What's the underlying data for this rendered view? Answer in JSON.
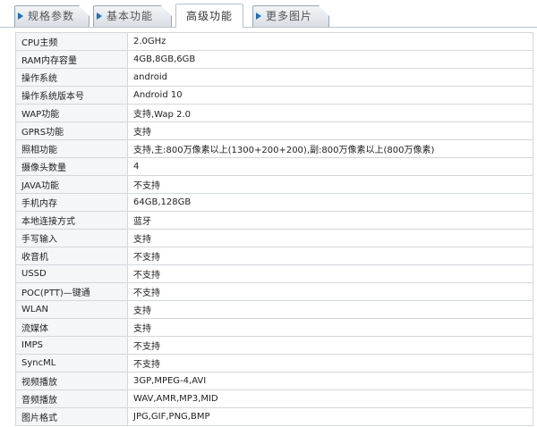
{
  "tabs": [
    {
      "label": "规格参数",
      "active": false
    },
    {
      "label": "基本功能",
      "active": false
    },
    {
      "label": "高级功能",
      "active": true
    },
    {
      "label": "更多图片",
      "active": false
    }
  ],
  "specs": [
    {
      "label": "CPU主频",
      "value": "2.0GHz"
    },
    {
      "label": "RAM内存容量",
      "value": "4GB,8GB,6GB"
    },
    {
      "label": "操作系统",
      "value": "android"
    },
    {
      "label": "操作系统版本号",
      "value": "Android 10"
    },
    {
      "label": "WAP功能",
      "value": "支持,Wap 2.0"
    },
    {
      "label": "GPRS功能",
      "value": "支持"
    },
    {
      "label": "照相功能",
      "value": "支持,主:800万像素以上(1300+200+200),副:800万像素以上(800万像素)"
    },
    {
      "label": "摄像头数量",
      "value": "4"
    },
    {
      "label": "JAVA功能",
      "value": "不支持"
    },
    {
      "label": "手机内存",
      "value": "64GB,128GB"
    },
    {
      "label": "本地连接方式",
      "value": "蓝牙"
    },
    {
      "label": "手写输入",
      "value": "支持"
    },
    {
      "label": "收音机",
      "value": "不支持"
    },
    {
      "label": "USSD",
      "value": "不支持"
    },
    {
      "label": "POC(PTT)—键通",
      "value": "不支持"
    },
    {
      "label": "WLAN",
      "value": "支持"
    },
    {
      "label": "流媒体",
      "value": "支持"
    },
    {
      "label": "IMPS",
      "value": "不支持"
    },
    {
      "label": "SyncML",
      "value": "不支持"
    },
    {
      "label": "视频播放",
      "value": "3GP,MPEG-4,AVI"
    },
    {
      "label": "音频播放",
      "value": "WAV,AMR,MP3,MID"
    },
    {
      "label": "图片格式",
      "value": "JPG,GIF,PNG,BMP"
    }
  ]
}
